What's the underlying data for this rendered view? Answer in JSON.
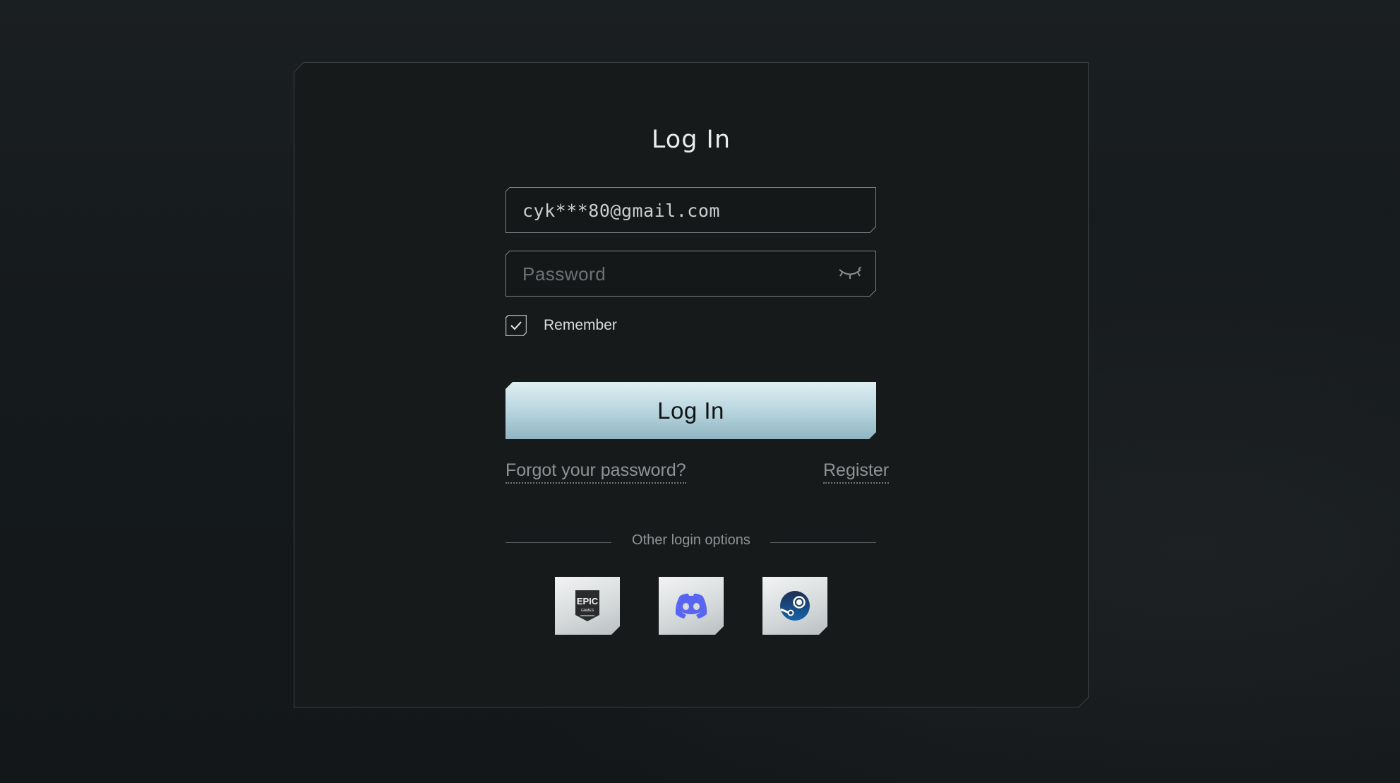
{
  "login": {
    "title": "Log In",
    "email_value": "cyk***80@gmail.com",
    "password_placeholder": "Password",
    "remember_label": "Remember",
    "remember_checked": true,
    "submit_label": "Log In",
    "forgot_label": "Forgot your password?",
    "register_label": "Register",
    "other_options_label": "Other login options"
  },
  "social": [
    {
      "name": "epic-games",
      "icon": "epic-games-icon",
      "text": "EPIC"
    },
    {
      "name": "discord",
      "icon": "discord-icon",
      "color": "#5865F2"
    },
    {
      "name": "steam",
      "icon": "steam-icon",
      "color": "#1b3c73"
    }
  ],
  "colors": {
    "accent": "#b5d3dc",
    "background": "#15191b",
    "panel": "#171a1a"
  }
}
